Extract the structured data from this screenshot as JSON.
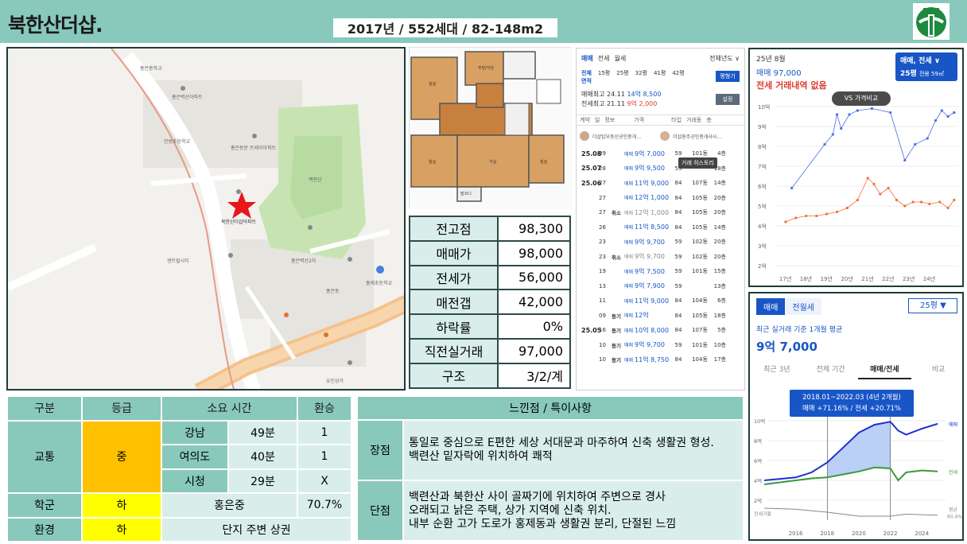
{
  "header": {
    "title": "북한산더샵.",
    "subtitle": "2017년 / 552세대 / 82-148m2"
  },
  "map": {
    "marker_label": "북한산더샵아파트",
    "place_labels": [
      "홍은중학교",
      "홍은벽산아파트",
      "인왕초등학교",
      "홍은동문 트레이아파트",
      "홍은벽산2차",
      "센트럴시티",
      "홍은동",
      "백련산",
      "홍제초등학교",
      "유진상가"
    ]
  },
  "floorplan": {
    "rooms": [
      "침실",
      "침실",
      "거실",
      "침실",
      "발코니",
      "주방/식당"
    ]
  },
  "prices": [
    {
      "label": "전고점",
      "value": "98,300"
    },
    {
      "label": "매매가",
      "value": "98,000"
    },
    {
      "label": "전세가",
      "value": "56,000"
    },
    {
      "label": "매전갭",
      "value": "42,000"
    },
    {
      "label": "하락률",
      "value": "0%"
    },
    {
      "label": "직전실거래",
      "value": "97,000"
    },
    {
      "label": "구조",
      "value": "3/2/계"
    }
  ],
  "transactions": {
    "tabs": [
      "매매",
      "전세",
      "월세"
    ],
    "year_filter": "전체년도 ∨",
    "size_label_1": "전체",
    "size_label_2": "면적",
    "sizes": [
      "15평",
      "25평",
      "32평",
      "41평",
      "42평"
    ],
    "size_btn": "평형기",
    "high_sale_label": "매매최고",
    "high_sale_date": "24.11",
    "high_sale_price": "14억 8,500",
    "high_jeonse_label": "전세최고",
    "high_jeonse_date": "21.11",
    "high_jeonse_price": "9억 2,000",
    "settings_btn": "설정",
    "columns": [
      "계약",
      "일",
      "정보",
      "가격",
      "타입",
      "거래동",
      "층"
    ],
    "agent1": "더샵탑부동산공인중개…",
    "agent2": "더샵원주공인중개사사…",
    "tooltip": "거래 히스토리",
    "rows": [
      {
        "ym": "25.08",
        "d": "09",
        "k": "",
        "t": "매매",
        "p": "9억 7,000",
        "ty": "59",
        "dong": "101동",
        "fl": "4층"
      },
      {
        "ym": "25.07",
        "d": "28",
        "k": "",
        "t": "매매",
        "p": "9억 9,500",
        "ty": "59",
        "dong": "",
        "fl": "18층"
      },
      {
        "ym": "25.06",
        "d": "27",
        "k": "",
        "t": "매매",
        "p": "11억 9,000",
        "ty": "84",
        "dong": "107동",
        "fl": "14층"
      },
      {
        "ym": "",
        "d": "27",
        "k": "",
        "t": "매매",
        "p": "12억 1,000",
        "ty": "84",
        "dong": "105동",
        "fl": "20층"
      },
      {
        "ym": "",
        "d": "27",
        "k": "취소",
        "t": "매매",
        "p": "12억 1,000",
        "ty": "84",
        "dong": "105동",
        "fl": "20층"
      },
      {
        "ym": "",
        "d": "26",
        "k": "",
        "t": "매매",
        "p": "11억 8,500",
        "ty": "84",
        "dong": "105동",
        "fl": "14층"
      },
      {
        "ym": "",
        "d": "23",
        "k": "",
        "t": "매매",
        "p": "9억 9,700",
        "ty": "59",
        "dong": "102동",
        "fl": "20층"
      },
      {
        "ym": "",
        "d": "23",
        "k": "취소",
        "t": "매매",
        "p": "9억 9,700",
        "ty": "59",
        "dong": "102동",
        "fl": "20층"
      },
      {
        "ym": "",
        "d": "19",
        "k": "",
        "t": "매매",
        "p": "9억 7,500",
        "ty": "59",
        "dong": "101동",
        "fl": "15층"
      },
      {
        "ym": "",
        "d": "13",
        "k": "",
        "t": "매매",
        "p": "9억 7,900",
        "ty": "59",
        "dong": "",
        "fl": "13층"
      },
      {
        "ym": "",
        "d": "11",
        "k": "",
        "t": "매매",
        "p": "11억 9,000",
        "ty": "84",
        "dong": "104동",
        "fl": "6층"
      },
      {
        "ym": "",
        "d": "09",
        "k": "등기",
        "t": "매매",
        "p": "12억",
        "ty": "84",
        "dong": "105동",
        "fl": "18층"
      },
      {
        "ym": "25.05",
        "d": "16",
        "k": "등기",
        "t": "매매",
        "p": "10억 8,000",
        "ty": "84",
        "dong": "107동",
        "fl": "5층"
      },
      {
        "ym": "",
        "d": "10",
        "k": "등기",
        "t": "매매",
        "p": "9억 9,700",
        "ty": "59",
        "dong": "101동",
        "fl": "10층"
      },
      {
        "ym": "",
        "d": "10",
        "k": "등기",
        "t": "매매",
        "p": "11억 8,750",
        "ty": "84",
        "dong": "104동",
        "fl": "17층"
      }
    ]
  },
  "chart1": {
    "date": "25년 8월",
    "value": "매매 97,000",
    "note": "전세 거래내역 없음",
    "type_box": "매매, 전세",
    "size_box": "25평",
    "size_sub": "전용 59㎡",
    "vs_button": "VS 가격비교",
    "y_ticks": [
      "10억",
      "9억",
      "8억",
      "7억",
      "6억",
      "5억",
      "4억",
      "3억",
      "2억"
    ],
    "x_ticks": [
      "17년",
      "18년",
      "19년",
      "20년",
      "21년",
      "22년",
      "23년",
      "24년"
    ]
  },
  "chart2": {
    "tab_on": "매매",
    "tab_off": "전월세",
    "size_select": "25평 ▼",
    "caption": "최근 실거래 기준 1개월 평균",
    "value": "9억 7,000",
    "periods": [
      "최근 3년",
      "전체 기간",
      "매매/전세",
      "비교"
    ],
    "tip_line1": "2018.01~2022.03 (4년 2개월)",
    "tip_line2": "매매 +71.16% / 전세 +20.71%",
    "y_ticks": [
      "10억",
      "8억",
      "6억",
      "4억",
      "2억"
    ],
    "x_ticks": [
      "2016",
      "2018",
      "2020",
      "2022",
      "2024"
    ],
    "label_sale": "매매",
    "label_jeonse": "전세",
    "label_ratio_left": "전세가율",
    "label_ratio_right": "평균",
    "label_ratio_value": "60.4%"
  },
  "chart_data": [
    {
      "type": "scatter",
      "title": "",
      "ylim": [
        2,
        10
      ],
      "series": [
        {
          "name": "매매",
          "color": "#4a6fe3",
          "points": [
            [
              2017.3,
              5.9
            ],
            [
              2018.9,
              8.1
            ],
            [
              2019.3,
              8.6
            ],
            [
              2019.5,
              9.6
            ],
            [
              2019.7,
              8.9
            ],
            [
              2020.1,
              9.6
            ],
            [
              2020.5,
              9.8
            ],
            [
              2021.2,
              9.9
            ],
            [
              2022.1,
              9.7
            ],
            [
              2022.8,
              7.3
            ],
            [
              2023.3,
              8.1
            ],
            [
              2023.9,
              8.4
            ],
            [
              2024.3,
              9.3
            ],
            [
              2024.6,
              9.8
            ],
            [
              2024.9,
              9.5
            ],
            [
              2025.2,
              9.7
            ]
          ]
        },
        {
          "name": "전세",
          "color": "#f07040",
          "points": [
            [
              2017.0,
              4.2
            ],
            [
              2017.5,
              4.4
            ],
            [
              2018.0,
              4.5
            ],
            [
              2018.5,
              4.5
            ],
            [
              2019.0,
              4.6
            ],
            [
              2019.5,
              4.7
            ],
            [
              2020.0,
              4.9
            ],
            [
              2020.5,
              5.3
            ],
            [
              2021.0,
              6.4
            ],
            [
              2021.3,
              6.1
            ],
            [
              2021.6,
              5.6
            ],
            [
              2022.0,
              5.9
            ],
            [
              2022.4,
              5.3
            ],
            [
              2022.8,
              5.0
            ],
            [
              2023.2,
              5.2
            ],
            [
              2023.6,
              5.2
            ],
            [
              2024.0,
              5.1
            ],
            [
              2024.5,
              5.2
            ],
            [
              2024.9,
              4.9
            ],
            [
              2025.2,
              5.3
            ]
          ]
        }
      ]
    },
    {
      "type": "line",
      "title": "",
      "ylim": [
        0,
        10
      ],
      "series": [
        {
          "name": "매매",
          "color": "#1e2fd0",
          "points": [
            [
              2014,
              4.0
            ],
            [
              2016,
              4.3
            ],
            [
              2017,
              4.8
            ],
            [
              2018,
              5.8
            ],
            [
              2019,
              7.3
            ],
            [
              2020,
              8.8
            ],
            [
              2021,
              9.6
            ],
            [
              2022,
              9.9
            ],
            [
              2022.5,
              9.0
            ],
            [
              2023,
              8.6
            ],
            [
              2024,
              9.2
            ],
            [
              2025,
              9.7
            ]
          ]
        },
        {
          "name": "전세",
          "color": "#3a9a3a",
          "points": [
            [
              2014,
              3.6
            ],
            [
              2016,
              4.0
            ],
            [
              2017,
              4.2
            ],
            [
              2018,
              4.3
            ],
            [
              2019,
              4.6
            ],
            [
              2020,
              4.9
            ],
            [
              2021,
              5.3
            ],
            [
              2022,
              5.2
            ],
            [
              2022.5,
              4.0
            ],
            [
              2023,
              4.8
            ],
            [
              2024,
              5.0
            ],
            [
              2025,
              4.9
            ]
          ]
        },
        {
          "name": "전세가율",
          "color": "#888888",
          "points": [
            [
              2014,
              1.2
            ],
            [
              2016,
              1.1
            ],
            [
              2018,
              0.8
            ],
            [
              2020,
              0.4
            ],
            [
              2022,
              0.4
            ],
            [
              2023,
              0.6
            ],
            [
              2025,
              0.5
            ]
          ]
        }
      ]
    }
  ],
  "grade_table": {
    "headers": [
      "구분",
      "등급",
      "소요 시간",
      "환승"
    ],
    "transport": {
      "label": "교통",
      "grade": "중",
      "rows": [
        {
          "dest": "강남",
          "time": "49분",
          "transfer": "1"
        },
        {
          "dest": "여의도",
          "time": "40분",
          "transfer": "1"
        },
        {
          "dest": "시청",
          "time": "29분",
          "transfer": "X"
        }
      ]
    },
    "school": {
      "label": "학군",
      "grade": "하",
      "name": "홍은중",
      "rate": "70.7%"
    },
    "env": {
      "label": "환경",
      "grade": "하",
      "desc": "단지 주변 상권"
    }
  },
  "feel_table": {
    "header": "느낀점 / 특이사항",
    "pros_label": "장점",
    "pros": [
      "통일로 중심으로 E편한 세상 서대문과 마주하여 신축 생활권 형성.",
      "백련산 밑자락에 위치하여 쾌적"
    ],
    "cons_label": "단점",
    "cons": [
      "백련산과 북한산 사이 골짜기에 위치하여 주변으로 경사",
      "오래되고 낡은 주택, 상가 지역에 신축 위치.",
      "내부 순환 고가 도로가 홍제동과 생활권 분리, 단절된 느낌"
    ]
  }
}
